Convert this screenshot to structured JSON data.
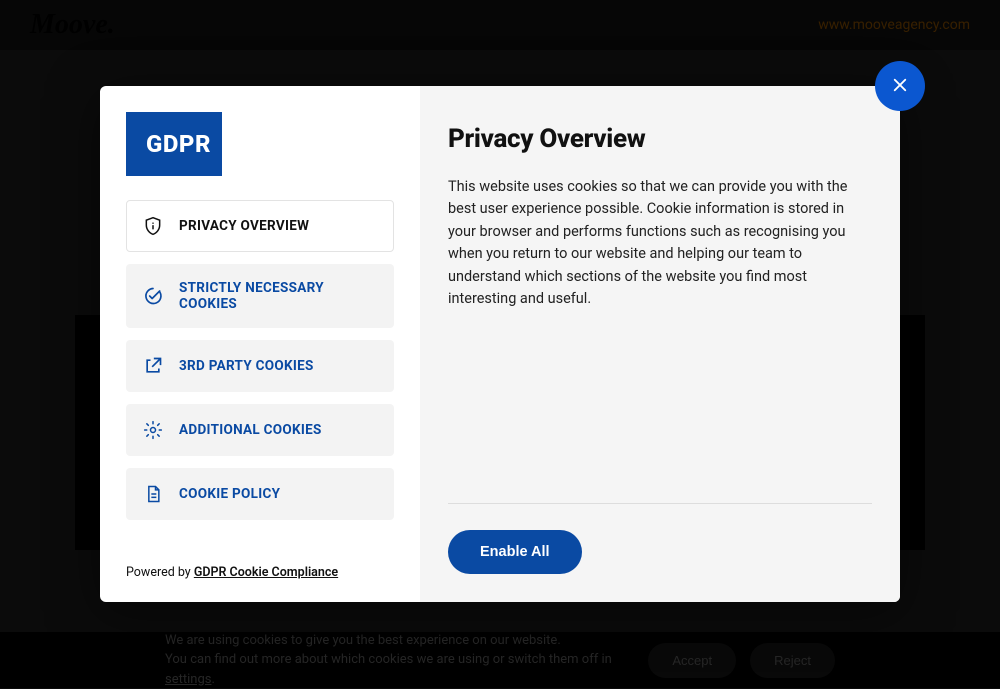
{
  "header": {
    "logo": "Moove.",
    "url": "www.mooveagency.com"
  },
  "cookie_bar": {
    "line1": "We are using cookies to give you the best experience on our website.",
    "line2_prefix": "You can find out more about which cookies we are using or switch them off in ",
    "settings_link": "settings",
    "line2_suffix": ".",
    "accept": "Accept",
    "reject": "Reject"
  },
  "modal": {
    "badge": "GDPR",
    "tabs": [
      {
        "label": "PRIVACY OVERVIEW"
      },
      {
        "label": "STRICTLY NECESSARY COOKIES"
      },
      {
        "label": "3RD PARTY COOKIES"
      },
      {
        "label": "ADDITIONAL COOKIES"
      },
      {
        "label": "COOKIE POLICY"
      }
    ],
    "powered_prefix": "Powered by ",
    "powered_link": "GDPR Cookie Compliance",
    "content": {
      "title": "Privacy Overview",
      "body": "This website uses cookies so that we can provide you with the best user experience possible. Cookie information is stored in your browser and performs functions such as recognising you when you return to our website and helping our team to understand which sections of the website you find most interesting and useful.",
      "enable_all": "Enable All"
    }
  }
}
